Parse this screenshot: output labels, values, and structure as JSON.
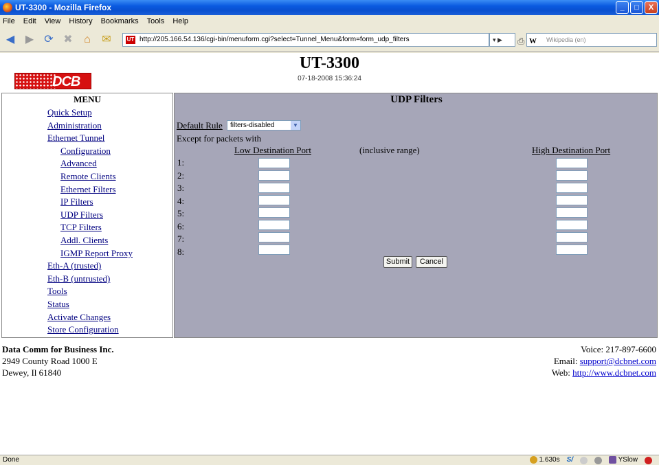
{
  "window": {
    "title": "UT-3300 - Mozilla Firefox",
    "minimize": "_",
    "maximize": "□",
    "close": "X"
  },
  "menubar": [
    "File",
    "Edit",
    "View",
    "History",
    "Bookmarks",
    "Tools",
    "Help"
  ],
  "nav": {
    "url": "http://205.166.54.136/cgi-bin/menuform.cgi?select=Tunnel_Menu&form=form_udp_filters",
    "favicon": "UT",
    "search_engine": "W",
    "search_placeholder": "Wikipedia (en)"
  },
  "header": {
    "logo_text": "DCB",
    "device_title": "UT-3300",
    "timestamp": "07-18-2008 15:36:24"
  },
  "sidebar": {
    "title": "MENU",
    "items": [
      "Quick Setup",
      "Administration",
      "Ethernet Tunnel",
      "Configuration",
      "Advanced",
      "Remote Clients",
      "Ethernet Filters",
      "IP Filters",
      "UDP Filters",
      "TCP Filters",
      "Addl. Clients",
      "IGMP Report Proxy",
      "Eth-A (trusted)",
      "Eth-B (untrusted)",
      "Tools",
      "Status",
      "Activate Changes",
      "Store Configuration"
    ]
  },
  "main": {
    "title": "UDP Filters",
    "default_rule_label": "Default Rule",
    "default_rule_value": "filters-disabled",
    "except_label": "Except for packets with",
    "low_port_header": "Low Destination Port",
    "range_label": "(inclusive range)",
    "high_port_header": "High Destination Port",
    "rows": [
      "1:",
      "2:",
      "3:",
      "4:",
      "5:",
      "6:",
      "7:",
      "8:"
    ],
    "submit_label": "Submit",
    "cancel_label": "Cancel"
  },
  "footer": {
    "company": "Data Comm for Business Inc.",
    "address1": "2949 County Road 1000 E",
    "address2": "Dewey, Il 61840",
    "voice": "Voice: 217-897-6600",
    "email_label": "Email: ",
    "email": "support@dcbnet.com",
    "web_label": "Web: ",
    "web": "http://www.dcbnet.com"
  },
  "status": {
    "text": "Done",
    "load_time": "1.630s",
    "yslow": "YSlow"
  }
}
